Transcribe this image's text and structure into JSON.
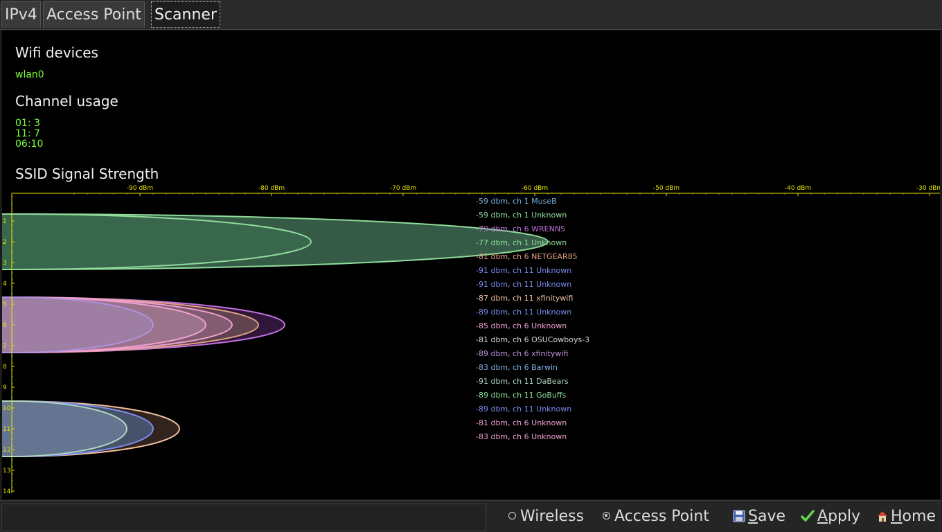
{
  "tabs": [
    {
      "label": "IPv4",
      "active": false
    },
    {
      "label": "Access Point",
      "active": false
    },
    {
      "label": "Scanner",
      "active": true
    }
  ],
  "sections": {
    "wifi_devices_title": "Wifi devices",
    "wifi_devices": [
      "wlan0"
    ],
    "channel_usage_title": "Channel usage",
    "channel_usage": [
      "01: 3",
      "11: 7",
      "06:10"
    ],
    "ssid_title": "SSID Signal Strength"
  },
  "chart_data": {
    "type": "scatter",
    "x_ticks": [
      "-90 dBm",
      "-80 dBm",
      "-70 dBm",
      "-60 dBm",
      "-50 dBm",
      "-40 dBm",
      "-30 dBm"
    ],
    "x_tick_values": [
      -90,
      -80,
      -70,
      -60,
      -50,
      -40,
      -30
    ],
    "y_ticks": [
      "1",
      "2",
      "3",
      "4",
      "5",
      "6",
      "7",
      "8",
      "9",
      "10",
      "11",
      "12",
      "13",
      "14"
    ],
    "axis_color": "#e5e500",
    "networks": [
      {
        "label": "-59 dbm, ch 1 MuseB",
        "dbm": -59,
        "channel": 1,
        "color": "#78b0e0"
      },
      {
        "label": "-59 dbm, ch 1 Unknown",
        "dbm": -59,
        "channel": 1,
        "color": "#8fdc9a"
      },
      {
        "label": "-79 dbm, ch 6 WRENNS",
        "dbm": -79,
        "channel": 6,
        "color": "#c070e0"
      },
      {
        "label": "-77 dbm, ch 1 Unknown",
        "dbm": -77,
        "channel": 1,
        "color": "#8fdc9a"
      },
      {
        "label": "-81 dbm, ch 6 NETGEAR85",
        "dbm": -81,
        "channel": 6,
        "color": "#e0a080"
      },
      {
        "label": "-91 dbm, ch 11 Unknown",
        "dbm": -91,
        "channel": 11,
        "color": "#7a8cf0"
      },
      {
        "label": "-91 dbm, ch 11 Unknown",
        "dbm": -91,
        "channel": 11,
        "color": "#7a8cf0"
      },
      {
        "label": "-87 dbm, ch 11 xfinitywifi",
        "dbm": -87,
        "channel": 11,
        "color": "#f0c0a0"
      },
      {
        "label": "-89 dbm, ch 11 Unknown",
        "dbm": -89,
        "channel": 11,
        "color": "#7a8cf0"
      },
      {
        "label": "-85 dbm, ch 6 Unknown",
        "dbm": -85,
        "channel": 6,
        "color": "#f0a0d0"
      },
      {
        "label": "-81 dbm, ch 6 OSUCowboys-3",
        "dbm": -81,
        "channel": 6,
        "color": "#d8d8d8"
      },
      {
        "label": "-89 dbm, ch 6 xfinitywifi",
        "dbm": -89,
        "channel": 6,
        "color": "#c090e0"
      },
      {
        "label": "-83 dbm, ch 6 Barwin",
        "dbm": -83,
        "channel": 6,
        "color": "#80b0e0"
      },
      {
        "label": "-91 dbm, ch 11 DaBears",
        "dbm": -91,
        "channel": 11,
        "color": "#b0d8c0"
      },
      {
        "label": "-89 dbm, ch 11 GoBuffs",
        "dbm": -89,
        "channel": 11,
        "color": "#8fdc9a"
      },
      {
        "label": "-89 dbm, ch 11 Unknown",
        "dbm": -89,
        "channel": 11,
        "color": "#7a8cf0"
      },
      {
        "label": "-81 dbm, ch 6 Unknown",
        "dbm": -81,
        "channel": 6,
        "color": "#f0a0d0"
      },
      {
        "label": "-83 dbm, ch 6 Unknown",
        "dbm": -83,
        "channel": 6,
        "color": "#f0a0d0"
      }
    ],
    "ellipses": [
      {
        "channel": 1,
        "dbm": -59,
        "fill": "#3e6b52",
        "stroke": "#8fdc9a"
      },
      {
        "channel": 1,
        "dbm": -77,
        "fill": "#3a6a50",
        "stroke": "#8fdc9a"
      },
      {
        "channel": 6,
        "dbm": -79,
        "fill": "#3a1a46",
        "stroke": "#c070e0"
      },
      {
        "channel": 6,
        "dbm": -81,
        "fill": "#6a4a52",
        "stroke": "#e0a080"
      },
      {
        "channel": 6,
        "dbm": -83,
        "fill": "#8a6078",
        "stroke": "#f0a0d0"
      },
      {
        "channel": 6,
        "dbm": -85,
        "fill": "#a07890",
        "stroke": "#f0a0d0"
      },
      {
        "channel": 6,
        "dbm": -89,
        "fill": "#a080a8",
        "stroke": "#b090e0"
      },
      {
        "channel": 11,
        "dbm": -87,
        "fill": "#3a2a24",
        "stroke": "#f0c0a0"
      },
      {
        "channel": 11,
        "dbm": -89,
        "fill": "#4a5a78",
        "stroke": "#7a8cf0"
      },
      {
        "channel": 11,
        "dbm": -91,
        "fill": "#6a7a98",
        "stroke": "#b0d8c0"
      }
    ]
  },
  "bottom": {
    "radio_wireless": "Wireless",
    "radio_access_point": "Access Point",
    "selected": "Access Point",
    "save_first": "S",
    "save_rest": "ave",
    "apply_first": "A",
    "apply_rest": "pply",
    "home_first": "H",
    "home_rest": "ome",
    "save_icon": "floppy-disk-icon",
    "apply_icon": "checkmark-icon",
    "home_icon": "house-icon"
  }
}
